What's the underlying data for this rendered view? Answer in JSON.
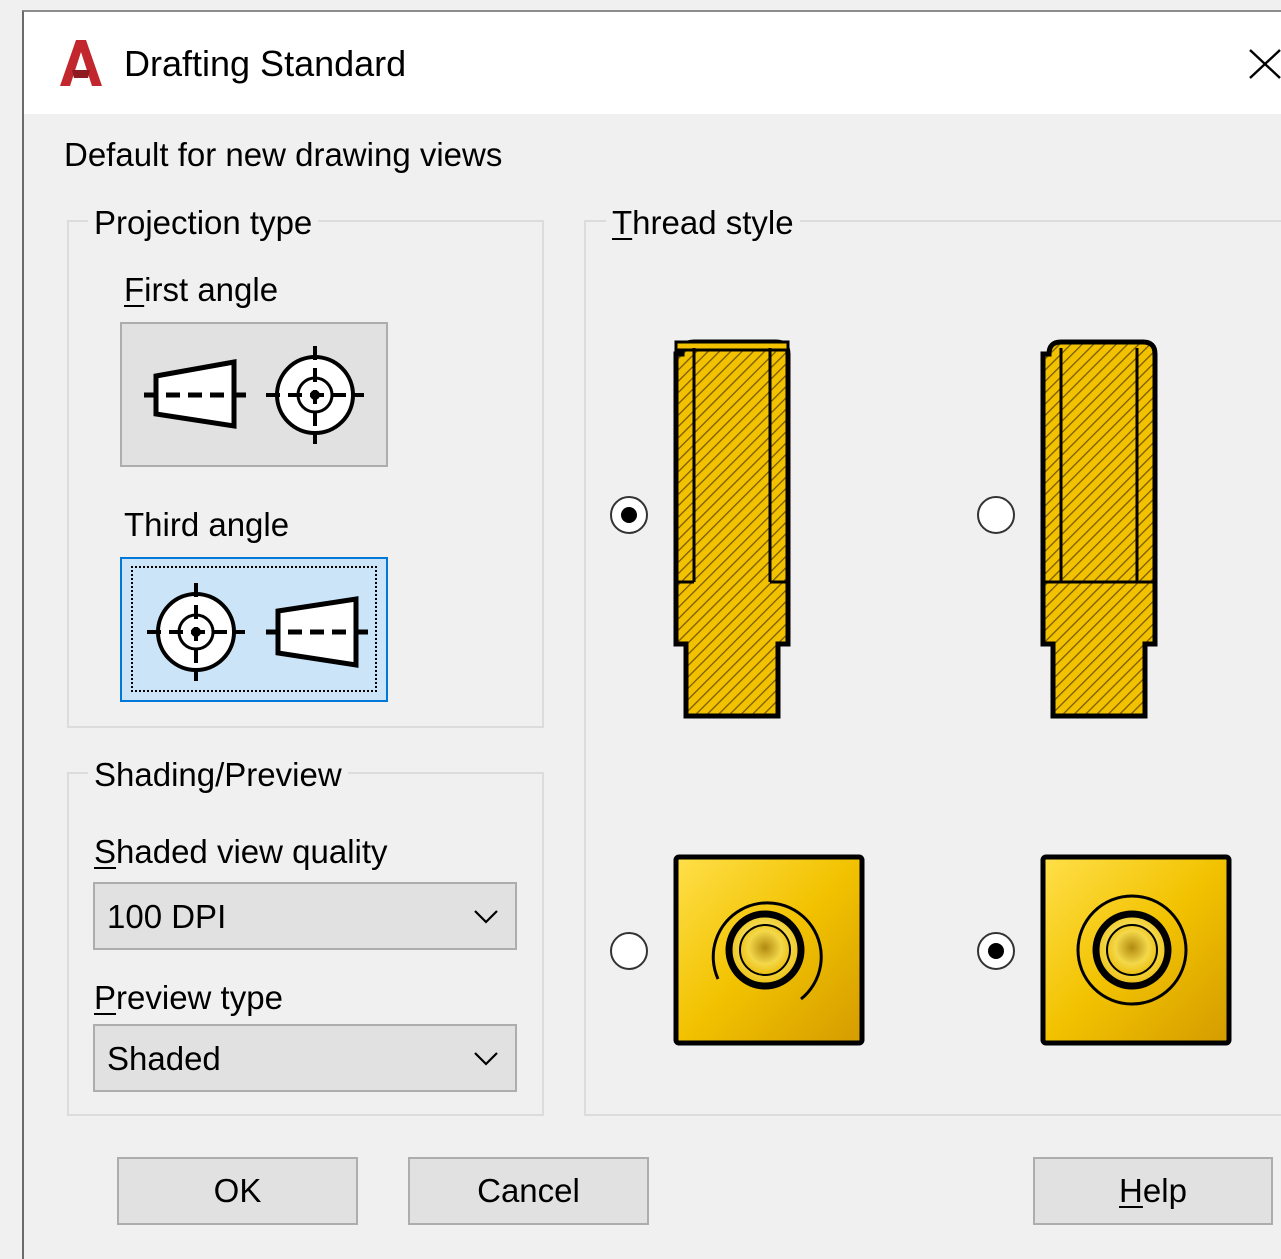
{
  "window": {
    "title": "Drafting Standard"
  },
  "heading": "Default for new drawing views",
  "projection": {
    "legend": "Projection type",
    "first_angle": {
      "label_first": "F",
      "label_rest": "irst angle"
    },
    "third_angle": {
      "label": "Third angle",
      "selected": true
    }
  },
  "shading": {
    "legend": "Shading/Preview",
    "quality": {
      "label_first": "S",
      "label_rest": "haded view quality",
      "value": "100 DPI"
    },
    "preview": {
      "label_first": "P",
      "label_rest": "review type",
      "value": "Shaded"
    }
  },
  "thread": {
    "legend_first": "T",
    "legend_rest": "hread style",
    "side_options_selected": [
      true,
      false
    ],
    "end_options_selected": [
      false,
      true
    ]
  },
  "buttons": {
    "ok": "OK",
    "cancel": "Cancel",
    "help_first": "H",
    "help_rest": "elp"
  },
  "colors": {
    "accent": "#0078d7",
    "thread_fill": "#f2c200",
    "app_icon": "#c1272d"
  },
  "icons": {
    "app": "autocad-logo-icon",
    "close": "close-icon",
    "dropdown": "chevron-down-icon"
  }
}
